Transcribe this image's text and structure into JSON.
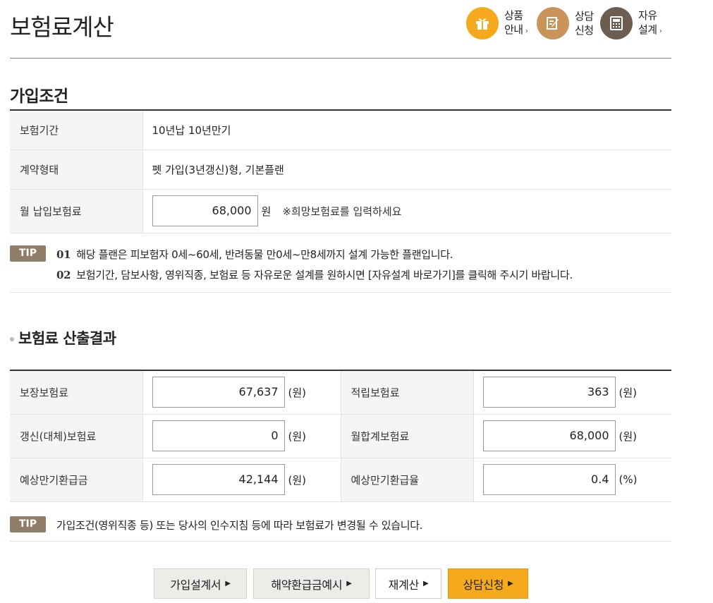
{
  "page": {
    "title": "보험료계산"
  },
  "quick_links": [
    {
      "line1": "상품",
      "line2": "안내",
      "icon": "gift-icon"
    },
    {
      "line1": "상담",
      "line2": "신청",
      "icon": "edit-document-icon"
    },
    {
      "line1": "자유",
      "line2": "설계",
      "icon": "calculator-icon"
    }
  ],
  "conditions": {
    "title": "가입조건",
    "rows": [
      {
        "label": "보험기간",
        "value": "10년납 10년만기"
      },
      {
        "label": "계약형태",
        "value": "펫 가입(3년갱신)형, 기본플랜"
      }
    ],
    "premium": {
      "label": "월 납입보험료",
      "value": "68,000",
      "unit": "원",
      "hint": "※희망보험료를 입력하세요"
    }
  },
  "tip1": {
    "badge": "TIP",
    "items": [
      {
        "num": "01",
        "text": "해당 플랜은 피보험자 0세~60세, 반려동물 만0세~만8세까지 설계 가능한 플랜입니다."
      },
      {
        "num": "02",
        "text": "보험기간, 담보사항, 영위직종, 보험료 등 자유로운 설계를 원하시면 [자유설계 바로가기]를 클릭해 주시기 바랍니다."
      }
    ]
  },
  "result": {
    "title": "보험료 산출결과",
    "rows": [
      {
        "left_label": "보장보험료",
        "left_value": "67,637",
        "left_unit": "(원)",
        "right_label": "적립보험료",
        "right_value": "363",
        "right_unit": "(원)"
      },
      {
        "left_label": "갱신(대체)보험료",
        "left_value": "0",
        "left_unit": "(원)",
        "right_label": "월합계보험료",
        "right_value": "68,000",
        "right_unit": "(원)"
      },
      {
        "left_label": "예상만기환급금",
        "left_value": "42,144",
        "left_unit": "(원)",
        "right_label": "예상만기환급율",
        "right_value": "0.4",
        "right_unit": "(%)"
      }
    ]
  },
  "tip2": {
    "badge": "TIP",
    "text": "가입조건(영위직종 등) 또는 당사의 인수지침 등에 따라 보험료가 변경될 수 있습니다."
  },
  "buttons": {
    "proposal": "가입설계서",
    "surrender": "해약환급금예시",
    "recalc": "재계산",
    "consult": "상담신청"
  },
  "colors": {
    "accent": "#f5a91c",
    "tip_badge": "#8f7d68",
    "consult_circle": "#c9945a",
    "design_circle": "#6b5d4f"
  }
}
